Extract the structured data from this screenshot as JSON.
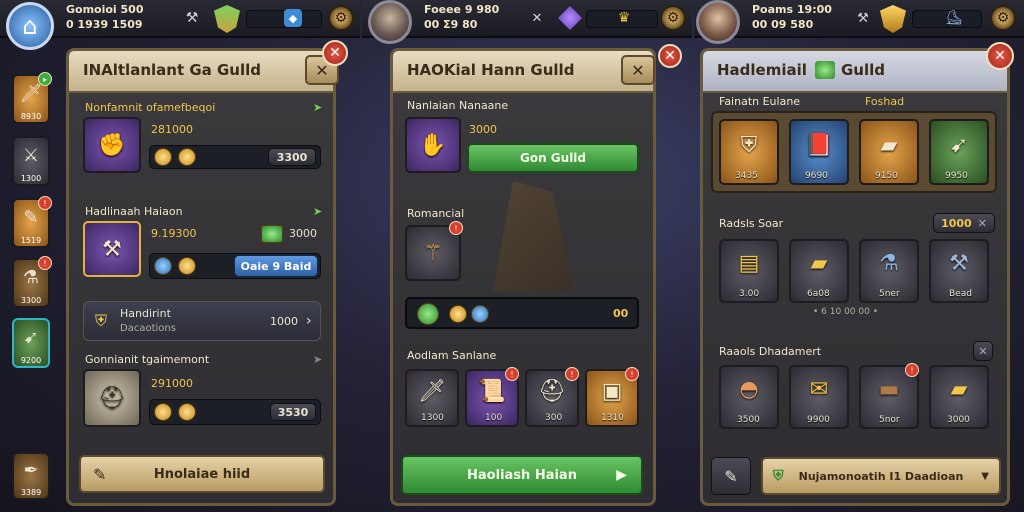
{
  "colors": {
    "accent_gold": "#f1c64a",
    "accent_green": "#6fd35a",
    "panel_border": "#6a5a3e",
    "close_red": "#d8402d"
  },
  "topbar": {
    "left": {
      "resource_1": "Gomoioi 500",
      "resource_2": "0 1939 1509"
    },
    "middle": {
      "resource_1": "Foeee 9 980",
      "resource_2": "00 Σ9 80"
    },
    "right": {
      "resource_1": "Poams 19:00",
      "resource_2": "00 09 580"
    }
  },
  "sidebar": {
    "items": [
      {
        "label": "8930"
      },
      {
        "label": "1300"
      },
      {
        "label": "1519"
      },
      {
        "label": "3300"
      },
      {
        "label": "9200"
      },
      {
        "label": "3389"
      }
    ]
  },
  "panel1": {
    "title": "INAltlanlant Ga Gulld",
    "sec1": {
      "title": "Nonfamnit ofamefbeqoi",
      "value": "281000",
      "button": "3300"
    },
    "sec2": {
      "title": "Hadlinaah Haiaon",
      "value": "9.19300",
      "extra": "3000",
      "button": "Oaie 9 Baid"
    },
    "info": {
      "title": "Handirint",
      "sub": "Dacaotions",
      "value": "1000"
    },
    "sec3": {
      "title": "Gonnianit tgaimemont",
      "value": "291000",
      "button": "3530"
    },
    "footer_button": "Hnolaiae hiid"
  },
  "panel2": {
    "title": "HAOKial Hann Gulld",
    "sec1": {
      "title": "Nanlaian Nanaane",
      "value": "3000",
      "button": "Gon Gulld"
    },
    "sec2": {
      "title": "Romancial"
    },
    "track_value": "00",
    "sec3": {
      "title": "Aodlam Sanlane",
      "items": [
        {
          "label": "1300"
        },
        {
          "label": "100"
        },
        {
          "label": "300"
        },
        {
          "label": "1310"
        }
      ]
    },
    "footer_button": "Haoliash Haian"
  },
  "panel3": {
    "title": "Hadlemiail",
    "title_suffix": "Gulld",
    "sec1": {
      "title": "Fainatn Eulane",
      "tag": "Foshad",
      "items": [
        {
          "label": "3435"
        },
        {
          "label": "9690"
        },
        {
          "label": "9150"
        },
        {
          "label": "9950"
        }
      ]
    },
    "sec2": {
      "title": "Radsls Soar",
      "counter": "1000",
      "items": [
        {
          "label": "3.00"
        },
        {
          "label": "6a08"
        },
        {
          "label": "5ner"
        },
        {
          "label": "Bead"
        }
      ],
      "note": "• 6 10 00 00 •"
    },
    "sec3": {
      "title": "Raaols Dhadamert",
      "items": [
        {
          "label": "3500"
        },
        {
          "label": "9900"
        },
        {
          "label": "5nor"
        },
        {
          "label": "3000"
        }
      ]
    },
    "footer_button": "Nujamonoatih I1 Daadioan"
  }
}
